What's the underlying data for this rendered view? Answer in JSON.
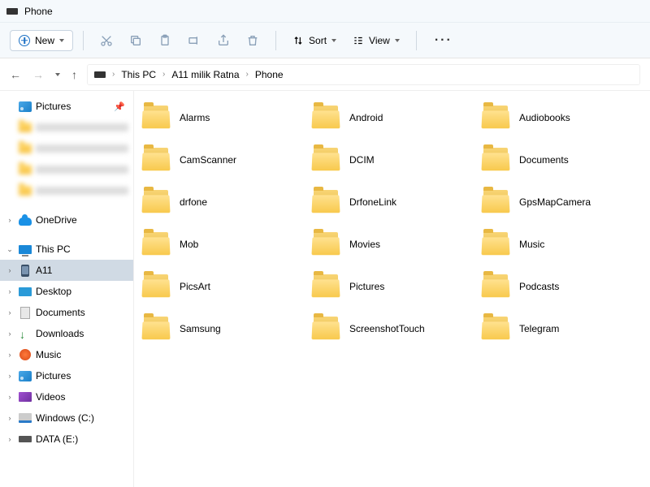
{
  "title": "Phone",
  "toolbar": {
    "new": "New",
    "sort": "Sort",
    "view": "View"
  },
  "breadcrumb": [
    "This PC",
    "A11 milik Ratna",
    "Phone"
  ],
  "sidebar": {
    "pictures": "Pictures",
    "onedrive": "OneDrive",
    "thispc": "This PC",
    "items": [
      {
        "label": "A11",
        "icon": "phone",
        "selected": true
      },
      {
        "label": "Desktop",
        "icon": "desktop"
      },
      {
        "label": "Documents",
        "icon": "doc"
      },
      {
        "label": "Downloads",
        "icon": "download"
      },
      {
        "label": "Music",
        "icon": "music"
      },
      {
        "label": "Pictures",
        "icon": "pictures"
      },
      {
        "label": "Videos",
        "icon": "video"
      },
      {
        "label": "Windows (C:)",
        "icon": "drive"
      },
      {
        "label": "DATA (E:)",
        "icon": "drive2"
      }
    ]
  },
  "folders": [
    "Alarms",
    "Android",
    "Audiobooks",
    "CamScanner",
    "DCIM",
    "Documents",
    "drfone",
    "DrfoneLink",
    "GpsMapCamera",
    "Mob",
    "Movies",
    "Music",
    "PicsArt",
    "Pictures",
    "Podcasts",
    "Samsung",
    "ScreenshotTouch",
    "Telegram"
  ]
}
